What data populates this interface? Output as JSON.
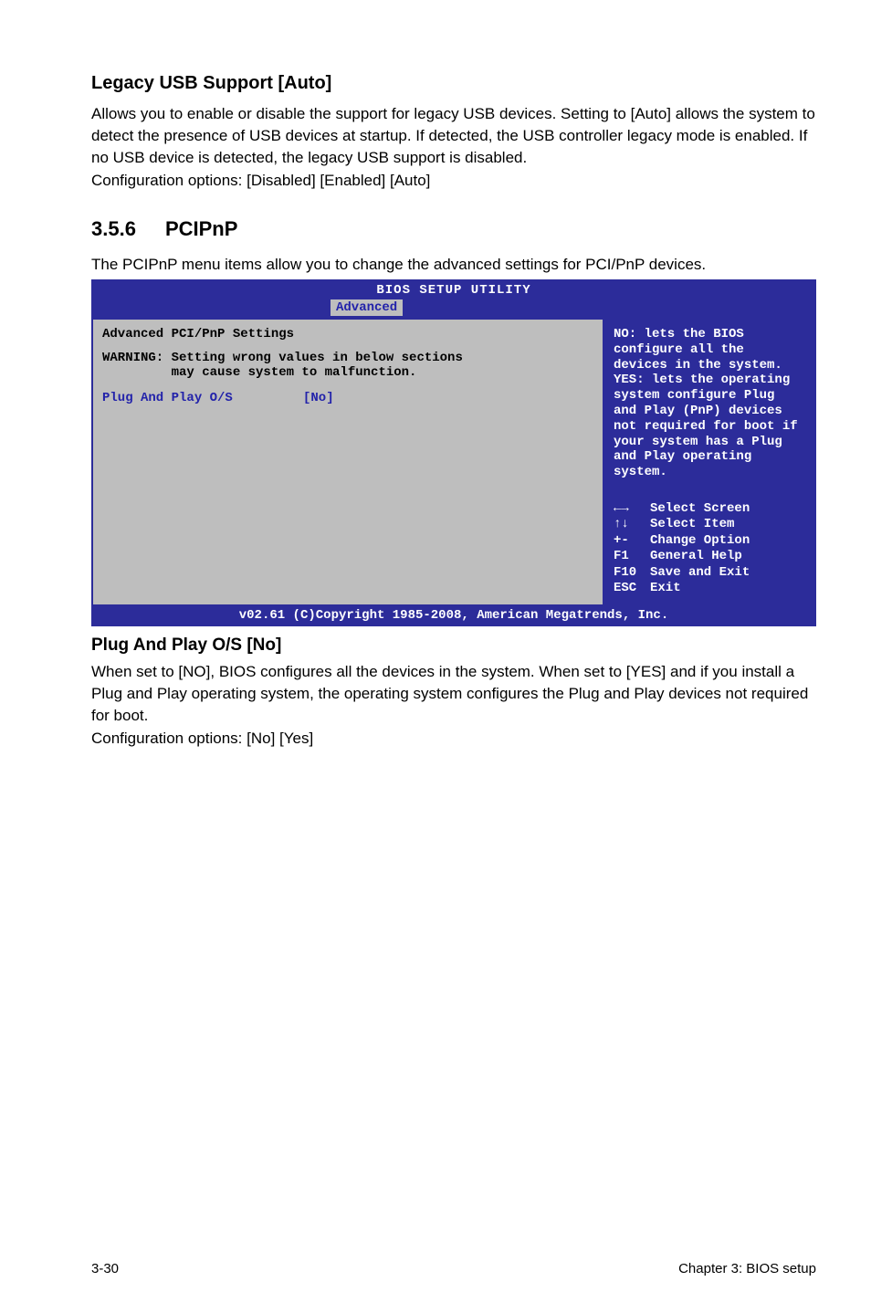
{
  "section1": {
    "title": "Legacy USB Support [Auto]",
    "para1": "Allows you to enable or disable the support for legacy USB devices. Setting to [Auto] allows the system to detect the presence of USB devices at startup. If detected, the USB controller legacy mode is enabled. If no USB device is detected, the legacy USB support is disabled.",
    "para2": "Configuration options: [Disabled] [Enabled] [Auto]"
  },
  "subsection": {
    "num": "3.5.6",
    "name": "PCIPnP",
    "intro": "The PCIPnP menu items allow you to change the advanced settings for PCI/PnP devices."
  },
  "bios": {
    "windowTitle": "BIOS SETUP UTILITY",
    "tabActive": "Advanced",
    "left": {
      "header": "Advanced PCI/PnP Settings",
      "warning": "WARNING: Setting wrong values in below sections\n         may cause system to malfunction.",
      "settingLabel": "Plug And Play O/S",
      "settingValue": "[No]"
    },
    "right": {
      "help": "NO: lets the BIOS configure all the devices in the system. YES: lets the operating system configure Plug and Play (PnP) devices not required for boot if your system has a Plug and Play operating system.",
      "keys": {
        "selectScreenSym": "←→",
        "selectScreen": "Select Screen",
        "selectItemSym": "↑↓",
        "selectItem": "Select Item",
        "changeSym": "+-",
        "change": " Change Option",
        "f1": "F1",
        "f1label": "General Help",
        "f10": "F10",
        "f10label": "Save and Exit",
        "esc": "ESC",
        "esclabel": "Exit"
      }
    },
    "footer": "v02.61 (C)Copyright 1985-2008, American Megatrends, Inc."
  },
  "section2": {
    "title": "Plug And Play O/S [No]",
    "para": "When set to [NO], BIOS configures all the devices in the system. When set to [YES] and if you install a Plug and Play operating system, the operating system configures the Plug and Play devices not required for boot.",
    "options": "Configuration options: [No] [Yes]"
  },
  "footer": {
    "left": "3-30",
    "right": "Chapter 3: BIOS setup"
  }
}
